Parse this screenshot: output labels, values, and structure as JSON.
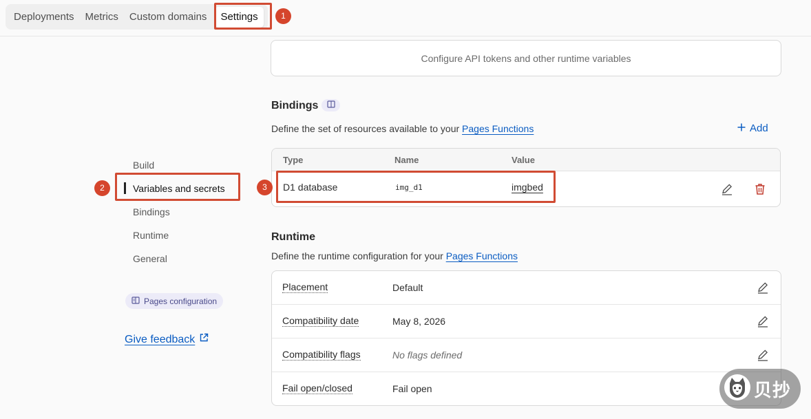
{
  "tabs": [
    "Deployments",
    "Metrics",
    "Custom domains",
    "Settings"
  ],
  "annotations": [
    "1",
    "2",
    "3"
  ],
  "sidebar": {
    "items": [
      "Build",
      "Variables and secrets",
      "Bindings",
      "Runtime",
      "General"
    ],
    "pages_config_label": "Pages configuration",
    "feedback_label": "Give feedback"
  },
  "env_card": {
    "text": "Configure API tokens and other runtime variables"
  },
  "bindings": {
    "title": "Bindings",
    "desc_prefix": "Define the set of resources available to your ",
    "desc_link": "Pages Functions",
    "add_label": "Add",
    "columns": [
      "Type",
      "Name",
      "Value"
    ],
    "row": {
      "type": "D1 database",
      "name": "img_d1",
      "value": "imgbed"
    }
  },
  "runtime": {
    "title": "Runtime",
    "desc_prefix": "Define the runtime configuration for your ",
    "desc_link": "Pages Functions",
    "rows": [
      {
        "key": "Placement",
        "value": "Default"
      },
      {
        "key": "Compatibility date",
        "value": "May 8, 2026"
      },
      {
        "key": "Compatibility flags",
        "value": "No flags defined"
      },
      {
        "key": "Fail open/closed",
        "value": "Fail open"
      }
    ]
  },
  "watermark": "贝抄",
  "colors": {
    "accent": "#0a5cc2",
    "annotation": "#d14b33",
    "danger": "#c0392b"
  }
}
